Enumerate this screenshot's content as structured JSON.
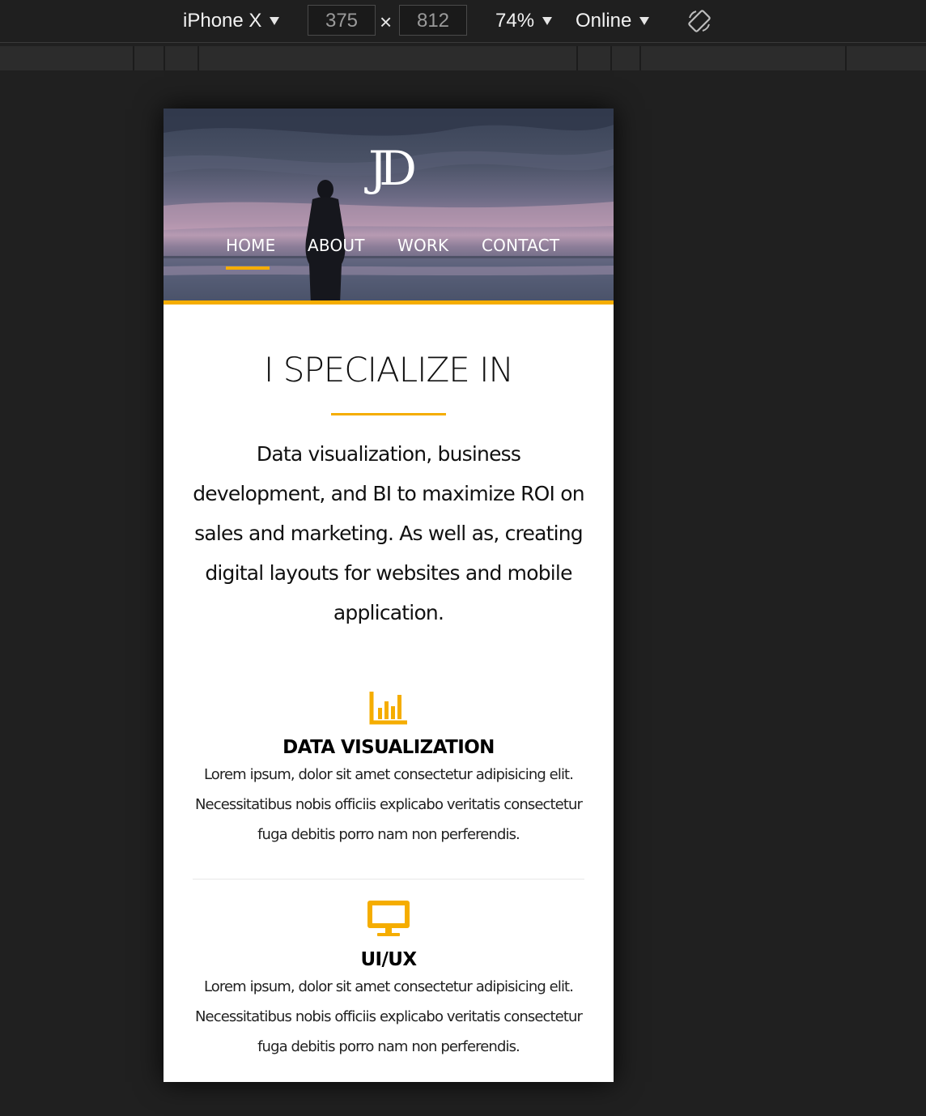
{
  "devtools": {
    "device_name": "iPhone X",
    "width_value": "375",
    "height_value": "812",
    "times_symbol": "×",
    "zoom": "74%",
    "network": "Online",
    "rotate_icon": "rotate-icon"
  },
  "site": {
    "logo": "JD",
    "nav": [
      {
        "label": "HOME",
        "active": true
      },
      {
        "label": "ABOUT",
        "active": false
      },
      {
        "label": "WORK",
        "active": false
      },
      {
        "label": "CONTACT",
        "active": false
      }
    ],
    "accent_color": "#f5ad00",
    "section_heading": "I SPECIALIZE IN",
    "lead_text": "Data visualization, business development, and BI to maximize ROI on sales and marketing. As well as, creating digital layouts for websites and mobile application.",
    "services": [
      {
        "icon": "bar-chart-icon",
        "title": "DATA VISUALIZATION",
        "text": "Lorem ipsum, dolor sit amet consectetur adipisicing elit. Necessitatibus nobis officiis explicabo veritatis consectetur fuga debitis porro nam non perferendis."
      },
      {
        "icon": "desktop-icon",
        "title": "UI/UX",
        "text": "Lorem ipsum, dolor sit amet consectetur adipisicing elit. Necessitatibus nobis officiis explicabo veritatis consectetur fuga debitis porro nam non perferendis."
      }
    ]
  }
}
